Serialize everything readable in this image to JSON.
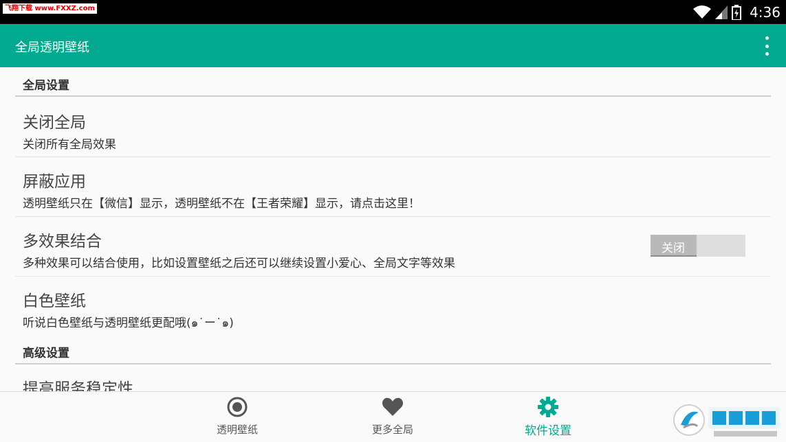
{
  "status_bar": {
    "watermark": "飞翔下载 www.FXXZ.com",
    "time": "4:36"
  },
  "app_bar": {
    "title": "全局透明壁纸"
  },
  "sections": [
    {
      "header": "全局设置"
    },
    {
      "header": "高级设置"
    }
  ],
  "prefs": {
    "close_global": {
      "title": "关闭全局",
      "summary": "关闭所有全局效果"
    },
    "block_apps": {
      "title": "屏蔽应用",
      "summary": "透明壁纸只在【微信】显示，透明壁纸不在【王者荣耀】显示，请点击这里！"
    },
    "multi_effect": {
      "title": "多效果结合",
      "summary": "多种效果可以结合使用，比如设置壁纸之后还可以继续设置小爱心、全局文字等效果",
      "toggle_label": "关闭"
    },
    "white_wallpaper": {
      "title": "白色壁纸",
      "summary": "听说白色壁纸与透明壁纸更配哦(๑˙ー˙๑)"
    },
    "service_stability": {
      "title": "提高服务稳定性"
    }
  },
  "bottom_nav": [
    {
      "label": "透明壁纸",
      "icon": "radio-button-icon"
    },
    {
      "label": "更多全局",
      "icon": "heart-icon"
    },
    {
      "label": "软件设置",
      "icon": "gear-icon"
    }
  ],
  "colors": {
    "primary": "#00a98f",
    "status_bar": "#000000"
  }
}
